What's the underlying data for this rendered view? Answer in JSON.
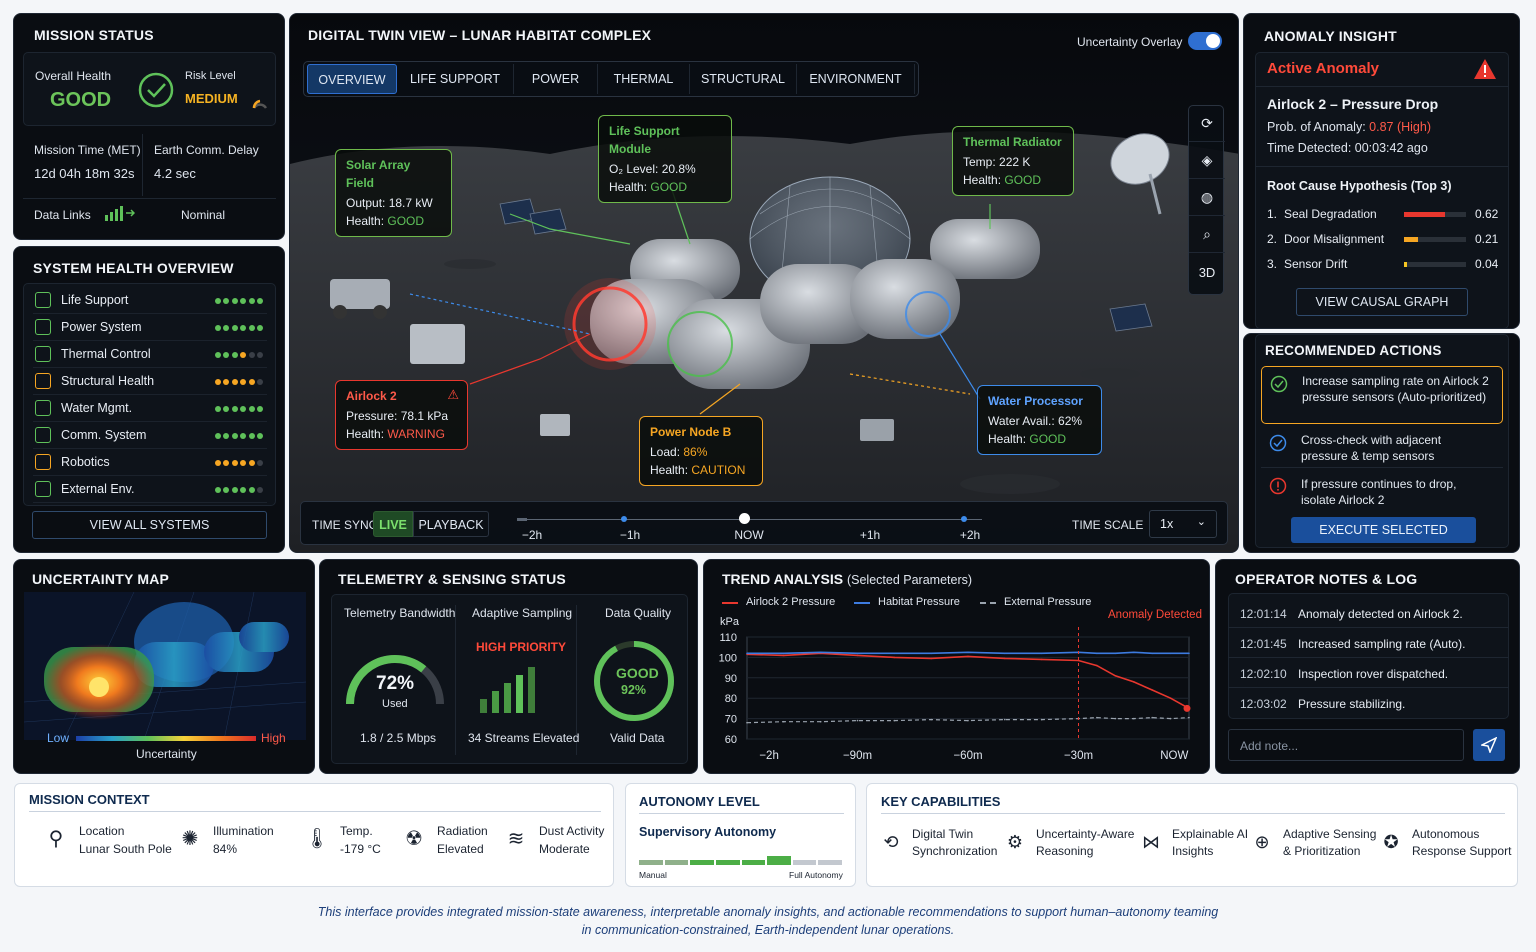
{
  "mission_status": {
    "title": "MISSION STATUS",
    "overall_health_label": "Overall Health",
    "overall_health_value": "GOOD",
    "risk_level_label": "Risk Level",
    "risk_level_value": "MEDIUM",
    "met_label": "Mission Time (MET)",
    "met_value": "12d 04h 18m 32s",
    "delay_label": "Earth Comm. Delay",
    "delay_value": "4.2 sec",
    "data_links_label": "Data Links",
    "data_links_value": "Nominal"
  },
  "system_health": {
    "title": "SYSTEM HEALTH OVERVIEW",
    "items": [
      {
        "label": "Life Support",
        "icon": "life-support-icon",
        "color": "#5fc15a",
        "dots": [
          "g",
          "g",
          "g",
          "g",
          "g",
          "g"
        ]
      },
      {
        "label": "Power System",
        "icon": "power-icon",
        "color": "#5fc15a",
        "dots": [
          "g",
          "g",
          "g",
          "g",
          "g",
          "g"
        ]
      },
      {
        "label": "Thermal Control",
        "icon": "thermal-icon",
        "color": "#5fc15a",
        "dots": [
          "g",
          "g",
          "g",
          "o",
          "x",
          "x"
        ]
      },
      {
        "label": "Structural Health",
        "icon": "warning-triangle-icon",
        "color": "#f6a623",
        "dots": [
          "o",
          "o",
          "o",
          "o",
          "o",
          "x"
        ]
      },
      {
        "label": "Water Mgmt.",
        "icon": "water-icon",
        "color": "#5fc15a",
        "dots": [
          "g",
          "g",
          "g",
          "g",
          "g",
          "g"
        ]
      },
      {
        "label": "Comm. System",
        "icon": "antenna-icon",
        "color": "#5fc15a",
        "dots": [
          "g",
          "g",
          "g",
          "g",
          "g",
          "g"
        ]
      },
      {
        "label": "Robotics",
        "icon": "robot-icon",
        "color": "#f6a623",
        "dots": [
          "o",
          "o",
          "o",
          "o",
          "o",
          "x"
        ]
      },
      {
        "label": "External Env.",
        "icon": "environment-icon",
        "color": "#5fc15a",
        "dots": [
          "g",
          "g",
          "g",
          "g",
          "g",
          "x"
        ]
      }
    ],
    "view_all": "VIEW ALL SYSTEMS"
  },
  "twin": {
    "title": "DIGITAL TWIN VIEW – LUNAR HABITAT COMPLEX",
    "overlay_label": "Uncertainty Overlay",
    "overlay_on": true,
    "tabs": [
      "OVERVIEW",
      "LIFE SUPPORT",
      "POWER",
      "THERMAL",
      "STRUCTURAL",
      "ENVIRONMENT"
    ],
    "active_tab": 0,
    "tool_3d": "3D",
    "callouts": {
      "solar": {
        "title": "Solar Array Field",
        "k1": "Output:",
        "v1": "18.7 kW",
        "k2": "Health:",
        "v2": "GOOD"
      },
      "life": {
        "title": "Life Support Module",
        "k1": "O₂ Level:",
        "v1": "20.8%",
        "k2": "Health:",
        "v2": "GOOD"
      },
      "thermal": {
        "title": "Thermal Radiator",
        "k1": "Temp:",
        "v1": "222 K",
        "k2": "Health:",
        "v2": "GOOD"
      },
      "airlock": {
        "title": "Airlock 2",
        "k1": "Pressure:",
        "v1": "78.1 kPa",
        "k2": "Health:",
        "v2": "WARNING"
      },
      "power": {
        "title": "Power Node B",
        "k1": "Load:",
        "v1": "86%",
        "k2": "Health:",
        "v2": "CAUTION"
      },
      "water": {
        "title": "Water Processor",
        "k1": "Water Avail.:",
        "v1": "62%",
        "k2": "Health:",
        "v2": "GOOD"
      }
    },
    "time_sync_label": "TIME SYNC",
    "live_label": "LIVE",
    "playback_label": "PLAYBACK",
    "timeline_ticks": [
      "−2h",
      "−1h",
      "NOW",
      "+1h",
      "+2h"
    ],
    "time_scale_label": "TIME SCALE",
    "time_scale_value": "1x"
  },
  "anomaly": {
    "title": "ANOMALY INSIGHT",
    "active_label": "Active Anomaly",
    "name": "Airlock 2 – Pressure Drop",
    "prob_label": "Prob. of Anomaly:",
    "prob_value": "0.87 (High)",
    "detected_label": "Time Detected:",
    "detected_value": "00:03:42 ago",
    "hypothesis_title": "Root Cause Hypothesis (Top 3)",
    "hypotheses": [
      {
        "rank": "1.",
        "label": "Seal Degradation",
        "value": "0.62",
        "score": 0.62,
        "color": "#e8372e"
      },
      {
        "rank": "2.",
        "label": "Door Misalignment",
        "value": "0.21",
        "score": 0.21,
        "color": "#f6a623"
      },
      {
        "rank": "3.",
        "label": "Sensor Drift",
        "value": "0.04",
        "score": 0.04,
        "color": "#f6c623"
      }
    ],
    "causal_button": "VIEW CAUSAL GRAPH"
  },
  "actions": {
    "title": "RECOMMENDED ACTIONS",
    "items": [
      {
        "text": "Increase sampling rate on Airlock 2 pressure sensors (Auto-prioritized)",
        "icon": "check-circle-icon"
      },
      {
        "text": "Cross-check with adjacent pressure & temp sensors",
        "icon": "check-circle-icon"
      },
      {
        "text": "If pressure continues to drop, isolate Airlock 2",
        "icon": "alert-circle-icon"
      }
    ],
    "execute": "EXECUTE SELECTED"
  },
  "uncertainty_map": {
    "title": "UNCERTAINTY MAP",
    "low": "Low",
    "high": "High",
    "caption": "Uncertainty"
  },
  "telemetry": {
    "title": "TELEMETRY & SENSING STATUS",
    "bandwidth_title": "Telemetry Bandwidth",
    "bandwidth_pct": "72%",
    "bandwidth_fraction": 0.72,
    "bandwidth_used": "Used",
    "bandwidth_detail": "1.8 / 2.5 Mbps",
    "sampling_title": "Adaptive Sampling",
    "sampling_priority": "HIGH PRIORITY",
    "sampling_detail": "34 Streams Elevated",
    "quality_title": "Data Quality",
    "quality_label": "GOOD",
    "quality_pct": "92%",
    "quality_fraction": 0.92,
    "quality_detail": "Valid Data"
  },
  "trend": {
    "title": "TREND ANALYSIS",
    "subtitle": "(Selected Parameters)",
    "anomaly_label": "Anomaly Detected",
    "unit": "kPa"
  },
  "chart_data": {
    "type": "line",
    "title": "TREND ANALYSIS",
    "ylabel": "kPa",
    "ylim": [
      60,
      110
    ],
    "yticks": [
      110,
      100,
      90,
      80,
      70,
      60
    ],
    "x_ticks": [
      "−2h",
      "−90m",
      "−60m",
      "−30m",
      "NOW"
    ],
    "x_minutes": [
      -120,
      -110,
      -100,
      -90,
      -80,
      -70,
      -60,
      -50,
      -40,
      -30,
      -25,
      -20,
      -15,
      -10,
      -5,
      0
    ],
    "series": [
      {
        "name": "Airlock 2 Pressure",
        "color": "#e8372e",
        "style": "solid",
        "values": [
          101.5,
          101,
          102,
          101,
          100,
          99.5,
          100.5,
          99.5,
          99,
          98.5,
          96,
          91,
          88,
          84,
          80,
          75
        ]
      },
      {
        "name": "Habitat Pressure",
        "color": "#3d7be0",
        "style": "solid",
        "values": [
          102,
          102,
          102.5,
          102,
          102,
          102,
          102.5,
          102,
          102,
          102.5,
          102,
          102,
          102.5,
          102,
          102,
          102
        ]
      },
      {
        "name": "External Pressure",
        "color": "#9aa3ae",
        "style": "dashed",
        "values": [
          68,
          68.5,
          68.5,
          69,
          69,
          69.5,
          69,
          69.5,
          69.5,
          70,
          70.5,
          70,
          70,
          70.5,
          70,
          70.5
        ]
      }
    ],
    "anomaly_x": -30
  },
  "log": {
    "title": "OPERATOR NOTES & LOG",
    "entries": [
      {
        "time": "12:01:14",
        "text": "Anomaly detected on Airlock 2."
      },
      {
        "time": "12:01:45",
        "text": "Increased sampling rate (Auto)."
      },
      {
        "time": "12:02:10",
        "text": "Inspection rover dispatched."
      },
      {
        "time": "12:03:02",
        "text": "Pressure stabilizing."
      }
    ],
    "placeholder": "Add note..."
  },
  "mission_context": {
    "title": "MISSION CONTEXT",
    "items": [
      {
        "label": "Location",
        "value": "Lunar South Pole",
        "icon": "location-pin-icon"
      },
      {
        "label": "Illumination",
        "value": "84%",
        "icon": "sun-icon"
      },
      {
        "label": "Temp.",
        "value": "-179 °C",
        "icon": "thermometer-icon"
      },
      {
        "label": "Radiation",
        "value": "Elevated",
        "icon": "radiation-icon"
      },
      {
        "label": "Dust Activity",
        "value": "Moderate",
        "icon": "dust-icon"
      }
    ]
  },
  "autonomy": {
    "title": "AUTONOMY LEVEL",
    "level": "Supervisory Autonomy",
    "level_fraction": 0.75,
    "min_label": "Manual",
    "max_label": "Full Autonomy"
  },
  "capabilities": {
    "title": "KEY CAPABILITIES",
    "items": [
      {
        "l1": "Digital Twin",
        "l2": "Synchronization",
        "icon": "sync-icon"
      },
      {
        "l1": "Uncertainty-Aware",
        "l2": "Reasoning",
        "icon": "brain-icon"
      },
      {
        "l1": "Explainable AI",
        "l2": "Insights",
        "icon": "network-icon"
      },
      {
        "l1": "Adaptive Sensing",
        "l2": "& Prioritization",
        "icon": "sensing-icon"
      },
      {
        "l1": "Autonomous",
        "l2": "Response Support",
        "icon": "response-icon"
      }
    ]
  },
  "footer": {
    "line1": "This interface provides integrated mission-state awareness, interpretable anomaly insights, and actionable recommendations to support human–autonomy teaming",
    "line2": "in communication-constrained, Earth-independent lunar operations."
  }
}
